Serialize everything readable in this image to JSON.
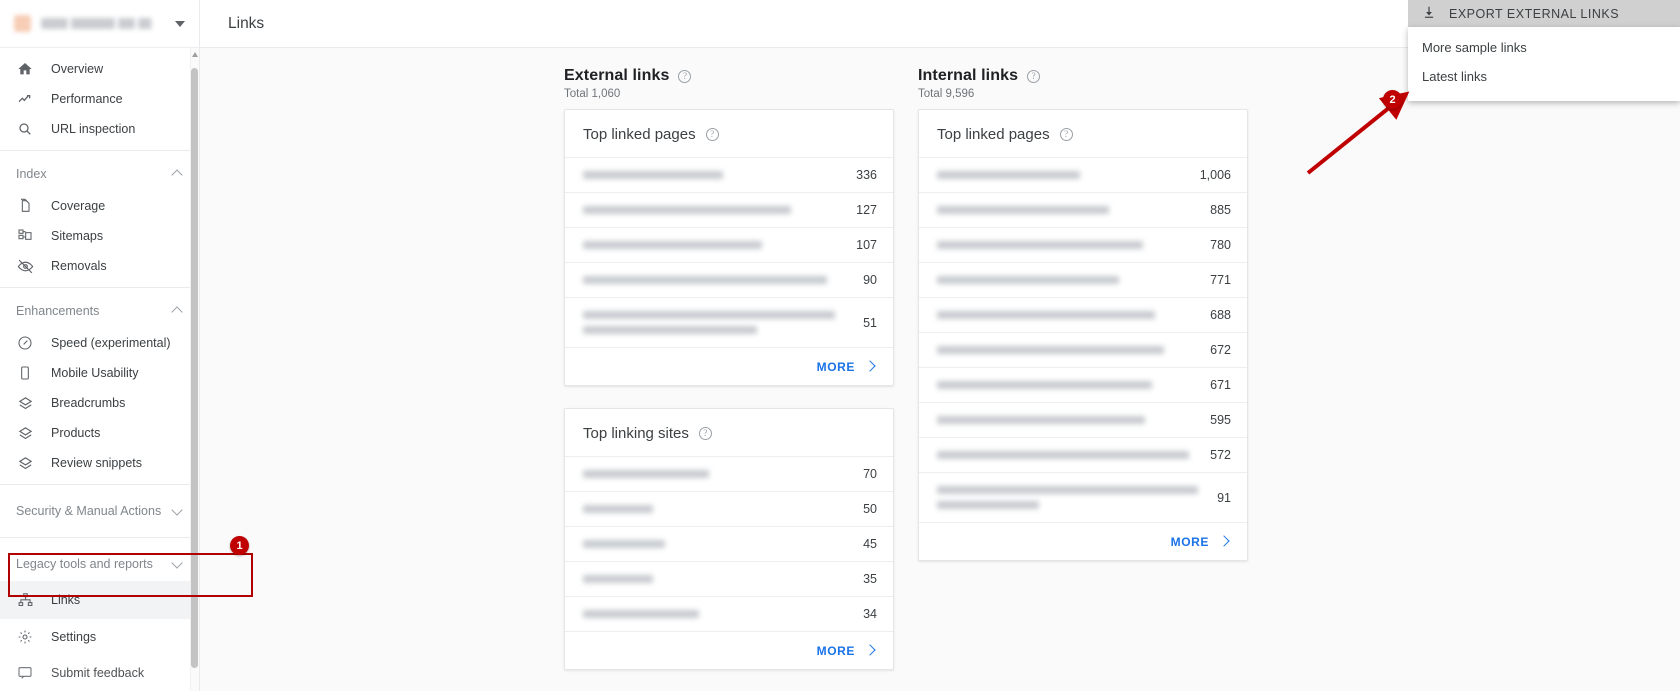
{
  "sidebar": {
    "property": {
      "name": "property-selector",
      "url_redacted": true
    },
    "primary": [
      {
        "label": "Overview",
        "icon": "home-icon"
      },
      {
        "label": "Performance",
        "icon": "trending-up-icon"
      },
      {
        "label": "URL inspection",
        "icon": "search-icon"
      }
    ],
    "sections": [
      {
        "label": "Index",
        "expanded": true,
        "items": [
          {
            "label": "Coverage",
            "icon": "document-copy-icon"
          },
          {
            "label": "Sitemaps",
            "icon": "sitemap-icon"
          },
          {
            "label": "Removals",
            "icon": "eye-off-icon"
          }
        ]
      },
      {
        "label": "Enhancements",
        "expanded": true,
        "items": [
          {
            "label": "Speed (experimental)",
            "icon": "speedometer-icon"
          },
          {
            "label": "Mobile Usability",
            "icon": "mobile-icon"
          },
          {
            "label": "Breadcrumbs",
            "icon": "layers-icon"
          },
          {
            "label": "Products",
            "icon": "layers-icon"
          },
          {
            "label": "Review snippets",
            "icon": "layers-icon"
          }
        ]
      },
      {
        "label": "Security & Manual Actions",
        "expanded": false,
        "items": []
      },
      {
        "label": "Legacy tools and reports",
        "expanded": false,
        "items": [
          {
            "label": "Links",
            "icon": "links-network-icon",
            "active": true
          },
          {
            "label": "Settings",
            "icon": "gear-icon"
          },
          {
            "label": "Submit feedback",
            "icon": "feedback-icon"
          }
        ]
      }
    ]
  },
  "header": {
    "title": "Links"
  },
  "export": {
    "button_label": "EXPORT EXTERNAL LINKS",
    "button_icon": "download-icon",
    "menu_items": [
      {
        "label": "More sample links"
      },
      {
        "label": "Latest links"
      }
    ]
  },
  "external": {
    "title": "External links",
    "total_label": "Total 1,060",
    "cards": [
      {
        "title": "Top linked pages",
        "rows": [
          {
            "label_redacted": true,
            "lines": [
              58
            ],
            "value": "336"
          },
          {
            "label_redacted": true,
            "lines": [
              86
            ],
            "value": "127"
          },
          {
            "label_redacted": true,
            "lines": [
              74
            ],
            "value": "107"
          },
          {
            "label_redacted": true,
            "lines": [
              101
            ],
            "value": "90"
          },
          {
            "label_redacted": true,
            "lines": [
              145,
              100
            ],
            "value": "51"
          }
        ],
        "more_label": "MORE"
      },
      {
        "title": "Top linking sites",
        "rows": [
          {
            "label_redacted": true,
            "lines": [
              52
            ],
            "value": "70"
          },
          {
            "label_redacted": true,
            "lines": [
              30
            ],
            "value": "50"
          },
          {
            "label_redacted": true,
            "lines": [
              35
            ],
            "value": "45"
          },
          {
            "label_redacted": true,
            "lines": [
              30
            ],
            "value": "35"
          },
          {
            "label_redacted": true,
            "lines": [
              48
            ],
            "value": "34"
          }
        ],
        "more_label": "MORE"
      }
    ]
  },
  "internal": {
    "title": "Internal links",
    "total_label": "Total 9,596",
    "cards": [
      {
        "title": "Top linked pages",
        "rows": [
          {
            "label_redacted": true,
            "lines": [
              59
            ],
            "value": "1,006"
          },
          {
            "label_redacted": true,
            "lines": [
              71
            ],
            "value": "885"
          },
          {
            "label_redacted": true,
            "lines": [
              85
            ],
            "value": "780"
          },
          {
            "label_redacted": true,
            "lines": [
              75
            ],
            "value": "771"
          },
          {
            "label_redacted": true,
            "lines": [
              91
            ],
            "value": "688"
          },
          {
            "label_redacted": true,
            "lines": [
              94
            ],
            "value": "672"
          },
          {
            "label_redacted": true,
            "lines": [
              89
            ],
            "value": "671"
          },
          {
            "label_redacted": true,
            "lines": [
              86
            ],
            "value": "595"
          },
          {
            "label_redacted": true,
            "lines": [
              104
            ],
            "value": "572"
          },
          {
            "label_redacted": true,
            "lines": [
              140,
              58
            ],
            "value": "91"
          }
        ],
        "more_label": "MORE"
      }
    ]
  },
  "annotations": [
    {
      "id": "1",
      "label": "1",
      "target": "sidebar-item-links"
    },
    {
      "id": "2",
      "label": "2",
      "target": "menu-item-latest-links"
    }
  ],
  "colors": {
    "accent_link": "#1a73e8",
    "annotation_red": "#c00000",
    "sidebar_bg": "#ffffff",
    "content_bg": "#fafafa"
  }
}
